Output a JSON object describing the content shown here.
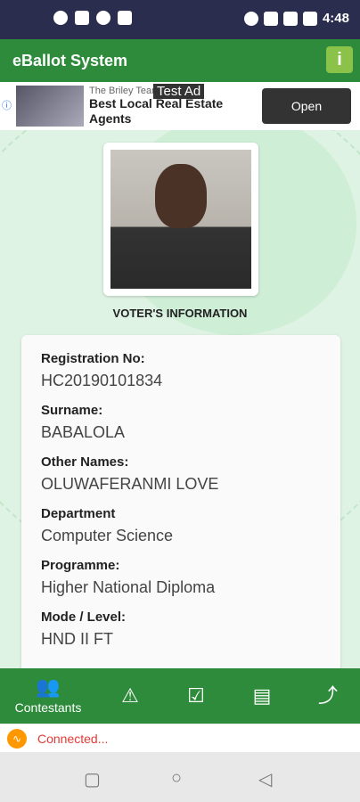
{
  "status": {
    "time": "4:48"
  },
  "app": {
    "title": "eBallot System"
  },
  "ad": {
    "label": "Test Ad",
    "advertiser": "The Briley Team",
    "headline": "Best Local Real Estate Agents",
    "open": "Open"
  },
  "voter": {
    "section_title": "VOTER'S INFORMATION",
    "fields": [
      {
        "label": "Registration No:",
        "value": "HC20190101834"
      },
      {
        "label": "Surname:",
        "value": "BABALOLA"
      },
      {
        "label": "Other Names:",
        "value": "OLUWAFERANMI LOVE"
      },
      {
        "label": "Department",
        "value": "Computer Science"
      },
      {
        "label": "Programme:",
        "value": "Higher National Diploma"
      },
      {
        "label": "Mode / Level:",
        "value": "HND II FT"
      }
    ]
  },
  "nav": {
    "contestants": "Contestants"
  },
  "connection": {
    "status": "Connected..."
  },
  "colors": {
    "primary": "#2e8b3c",
    "accent": "#8bc34a",
    "background": "#dff3e4"
  }
}
